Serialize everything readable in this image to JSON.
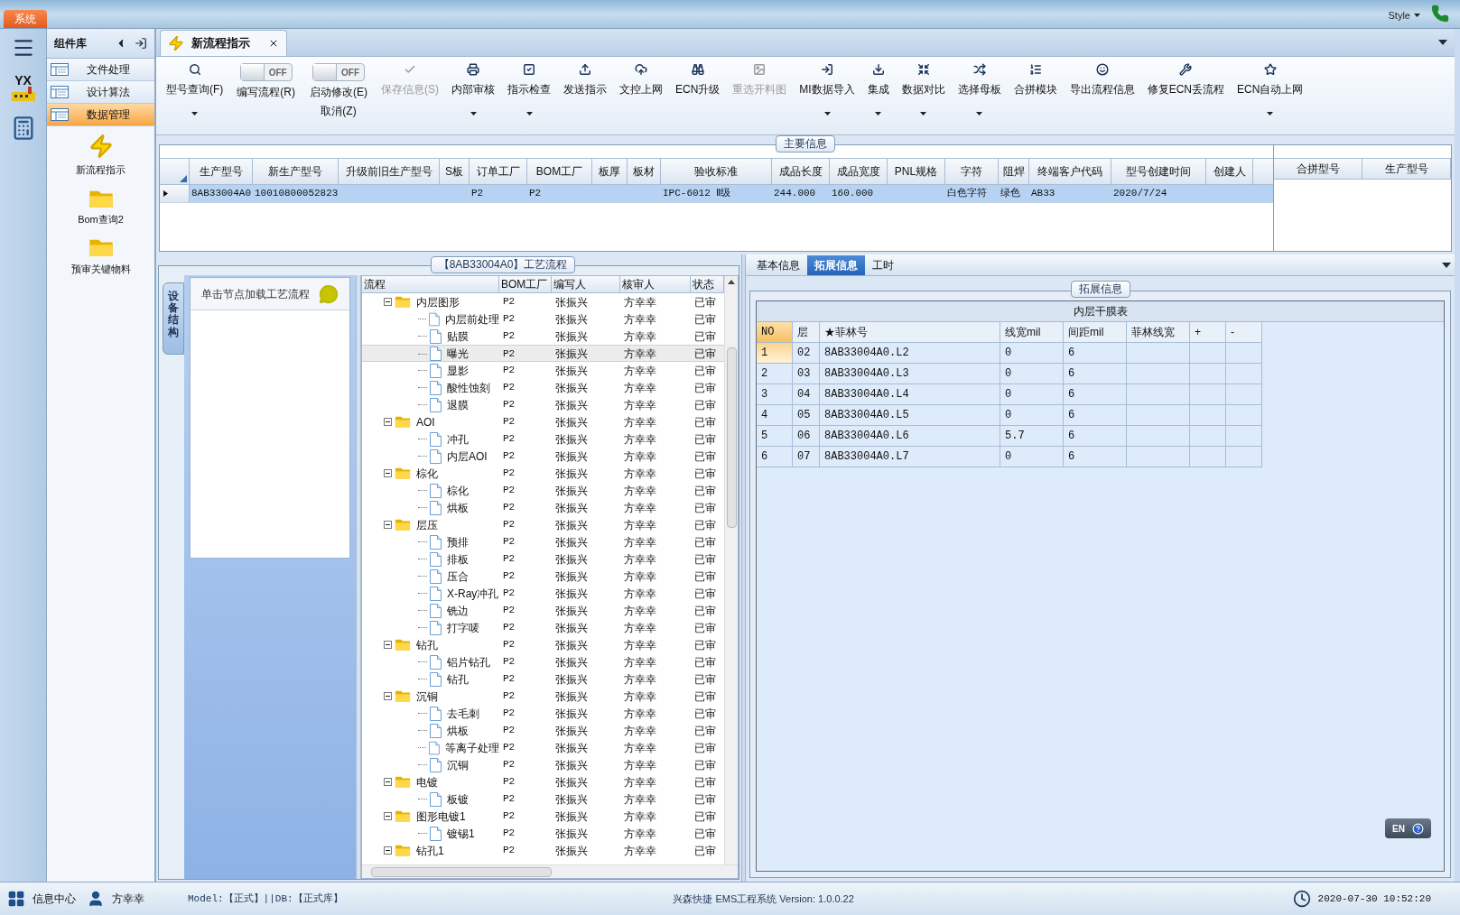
{
  "top_bar": {
    "system_tab": "系统",
    "style_menu": "Style"
  },
  "rail": {
    "logo_text": "YX"
  },
  "sidebar": {
    "title": "组件库",
    "items": [
      {
        "label": "文件处理",
        "selected": false
      },
      {
        "label": "设计算法",
        "selected": false
      },
      {
        "label": "数据管理",
        "selected": true
      }
    ],
    "shortcuts": [
      {
        "label": "新流程指示"
      },
      {
        "label": "Bom查询2"
      },
      {
        "label": "预审关键物料"
      }
    ]
  },
  "document_tabs": [
    {
      "label": "新流程指示",
      "selected": true
    }
  ],
  "toolbar": [
    {
      "kind": "button",
      "label": "型号查询(F)",
      "disabled": false,
      "dropdown": true
    },
    {
      "kind": "toggle",
      "label": "编写流程(R)",
      "on": false,
      "state_text": "OFF"
    },
    {
      "kind": "toggle",
      "label": "启动修改(E)",
      "sublabel": "取消(Z)",
      "on": false,
      "state_text": "OFF"
    },
    {
      "kind": "button",
      "label": "保存信息(S)",
      "disabled": true,
      "dropdown": false
    },
    {
      "kind": "button",
      "label": "内部审核",
      "disabled": false,
      "dropdown": true
    },
    {
      "kind": "button",
      "label": "指示检查",
      "disabled": false,
      "dropdown": true
    },
    {
      "kind": "button",
      "label": "发送指示",
      "disabled": false,
      "dropdown": false
    },
    {
      "kind": "button",
      "label": "文控上网",
      "disabled": false,
      "dropdown": false
    },
    {
      "kind": "button",
      "label": "ECN升级",
      "disabled": false,
      "dropdown": false
    },
    {
      "kind": "button",
      "label": "重选开料图",
      "disabled": true,
      "dropdown": false
    },
    {
      "kind": "button",
      "label": "MI数据导入",
      "disabled": false,
      "dropdown": true
    },
    {
      "kind": "button",
      "label": "集成",
      "disabled": false,
      "dropdown": true
    },
    {
      "kind": "button",
      "label": "数据对比",
      "disabled": false,
      "dropdown": true
    },
    {
      "kind": "button",
      "label": "选择母板",
      "disabled": false,
      "dropdown": true
    },
    {
      "kind": "button",
      "label": "合拼模块",
      "disabled": false,
      "dropdown": false
    },
    {
      "kind": "button",
      "label": "导出流程信息",
      "disabled": false,
      "dropdown": false
    },
    {
      "kind": "button",
      "label": "修复ECN丢流程",
      "disabled": false,
      "dropdown": false
    },
    {
      "kind": "button",
      "label": "ECN自动上网",
      "disabled": false,
      "dropdown": true
    }
  ],
  "main_info": {
    "title": "主要信息",
    "columns": [
      "生产型号",
      "新生产型号",
      "升级前旧生产型号",
      "S板",
      "订单工厂",
      "BOM工厂",
      "板厚",
      "板材",
      "验收标准",
      "成品长度",
      "成品宽度",
      "PNL规格",
      "字符",
      "阻焊",
      "终端客户代码",
      "型号创建时间",
      "创建人"
    ],
    "rows": [
      {
        "selected": true,
        "cells": [
          "8AB33004A0",
          "10010800052823",
          null,
          null,
          "P2",
          "P2",
          null,
          null,
          "IPC-6012 Ⅱ级",
          "244.000",
          "160.000",
          null,
          "白色字符",
          "绿色",
          "AB33",
          "2020/7/24",
          null
        ]
      }
    ],
    "merge_columns": [
      "合拼型号",
      "生产型号"
    ]
  },
  "process": {
    "title": "【8AB33004A0】工艺流程",
    "side_tab": "设备结构",
    "hint": "单击节点加载工艺流程",
    "columns": [
      "流程",
      "BOM工厂",
      "编写人",
      "核审人",
      "状态"
    ],
    "tree": [
      {
        "kind": "folder",
        "name": "内层图形",
        "bom": "P2",
        "writer": "张振兴",
        "reviewer": "方幸幸",
        "status": "已审",
        "expanded": true,
        "selected": false,
        "children": [
          {
            "kind": "step",
            "name": "内层前处理",
            "bom": "P2",
            "writer": "张振兴",
            "reviewer": "方幸幸",
            "status": "已审",
            "selected": false
          },
          {
            "kind": "step",
            "name": "贴膜",
            "bom": "P2",
            "writer": "张振兴",
            "reviewer": "方幸幸",
            "status": "已审",
            "selected": false
          },
          {
            "kind": "step",
            "name": "曝光",
            "bom": "P2",
            "writer": "张振兴",
            "reviewer": "方幸幸",
            "status": "已审",
            "selected": true
          },
          {
            "kind": "step",
            "name": "显影",
            "bom": "P2",
            "writer": "张振兴",
            "reviewer": "方幸幸",
            "status": "已审",
            "selected": false
          },
          {
            "kind": "step",
            "name": "酸性蚀刻",
            "bom": "P2",
            "writer": "张振兴",
            "reviewer": "方幸幸",
            "status": "已审",
            "selected": false
          },
          {
            "kind": "step",
            "name": "退膜",
            "bom": "P2",
            "writer": "张振兴",
            "reviewer": "方幸幸",
            "status": "已审",
            "selected": false
          }
        ]
      },
      {
        "kind": "folder",
        "name": "AOI",
        "bom": "P2",
        "writer": "张振兴",
        "reviewer": "方幸幸",
        "status": "已审",
        "expanded": true,
        "selected": false,
        "children": [
          {
            "kind": "step",
            "name": "冲孔",
            "bom": "P2",
            "writer": "张振兴",
            "reviewer": "方幸幸",
            "status": "已审",
            "selected": false
          },
          {
            "kind": "step",
            "name": "内层AOI",
            "bom": "P2",
            "writer": "张振兴",
            "reviewer": "方幸幸",
            "status": "已审",
            "selected": false
          }
        ]
      },
      {
        "kind": "folder",
        "name": "棕化",
        "bom": "P2",
        "writer": "张振兴",
        "reviewer": "方幸幸",
        "status": "已审",
        "expanded": true,
        "selected": false,
        "children": [
          {
            "kind": "step",
            "name": "棕化",
            "bom": "P2",
            "writer": "张振兴",
            "reviewer": "方幸幸",
            "status": "已审",
            "selected": false
          },
          {
            "kind": "step",
            "name": "烘板",
            "bom": "P2",
            "writer": "张振兴",
            "reviewer": "方幸幸",
            "status": "已审",
            "selected": false
          }
        ]
      },
      {
        "kind": "folder",
        "name": "层压",
        "bom": "P2",
        "writer": "张振兴",
        "reviewer": "方幸幸",
        "status": "已审",
        "expanded": true,
        "selected": false,
        "children": [
          {
            "kind": "step",
            "name": "预排",
            "bom": "P2",
            "writer": "张振兴",
            "reviewer": "方幸幸",
            "status": "已审",
            "selected": false
          },
          {
            "kind": "step",
            "name": "排板",
            "bom": "P2",
            "writer": "张振兴",
            "reviewer": "方幸幸",
            "status": "已审",
            "selected": false
          },
          {
            "kind": "step",
            "name": "压合",
            "bom": "P2",
            "writer": "张振兴",
            "reviewer": "方幸幸",
            "status": "已审",
            "selected": false
          },
          {
            "kind": "step",
            "name": "X-Ray冲孔",
            "bom": "P2",
            "writer": "张振兴",
            "reviewer": "方幸幸",
            "status": "已审",
            "selected": false
          },
          {
            "kind": "step",
            "name": "铣边",
            "bom": "P2",
            "writer": "张振兴",
            "reviewer": "方幸幸",
            "status": "已审",
            "selected": false
          },
          {
            "kind": "step",
            "name": "打字唛",
            "bom": "P2",
            "writer": "张振兴",
            "reviewer": "方幸幸",
            "status": "已审",
            "selected": false
          }
        ]
      },
      {
        "kind": "folder",
        "name": "钻孔",
        "bom": "P2",
        "writer": "张振兴",
        "reviewer": "方幸幸",
        "status": "已审",
        "expanded": true,
        "selected": false,
        "children": [
          {
            "kind": "step",
            "name": "铝片钻孔",
            "bom": "P2",
            "writer": "张振兴",
            "reviewer": "方幸幸",
            "status": "已审",
            "selected": false
          },
          {
            "kind": "step",
            "name": "钻孔",
            "bom": "P2",
            "writer": "张振兴",
            "reviewer": "方幸幸",
            "status": "已审",
            "selected": false
          }
        ]
      },
      {
        "kind": "folder",
        "name": "沉铜",
        "bom": "P2",
        "writer": "张振兴",
        "reviewer": "方幸幸",
        "status": "已审",
        "expanded": true,
        "selected": false,
        "children": [
          {
            "kind": "step",
            "name": "去毛刺",
            "bom": "P2",
            "writer": "张振兴",
            "reviewer": "方幸幸",
            "status": "已审",
            "selected": false
          },
          {
            "kind": "step",
            "name": "烘板",
            "bom": "P2",
            "writer": "张振兴",
            "reviewer": "方幸幸",
            "status": "已审",
            "selected": false
          },
          {
            "kind": "step",
            "name": "等离子处理",
            "bom": "P2",
            "writer": "张振兴",
            "reviewer": "方幸幸",
            "status": "已审",
            "selected": false
          },
          {
            "kind": "step",
            "name": "沉铜",
            "bom": "P2",
            "writer": "张振兴",
            "reviewer": "方幸幸",
            "status": "已审",
            "selected": false
          }
        ]
      },
      {
        "kind": "folder",
        "name": "电镀",
        "bom": "P2",
        "writer": "张振兴",
        "reviewer": "方幸幸",
        "status": "已审",
        "expanded": true,
        "selected": false,
        "children": [
          {
            "kind": "step",
            "name": "板镀",
            "bom": "P2",
            "writer": "张振兴",
            "reviewer": "方幸幸",
            "status": "已审",
            "selected": false
          }
        ]
      },
      {
        "kind": "folder",
        "name": "图形电镀1",
        "bom": "P2",
        "writer": "张振兴",
        "reviewer": "方幸幸",
        "status": "已审",
        "expanded": true,
        "selected": false,
        "children": [
          {
            "kind": "step",
            "name": "镀锡1",
            "bom": "P2",
            "writer": "张振兴",
            "reviewer": "方幸幸",
            "status": "已审",
            "selected": false
          }
        ]
      },
      {
        "kind": "folder",
        "name": "钻孔1",
        "bom": "P2",
        "writer": "张振兴",
        "reviewer": "方幸幸",
        "status": "已审",
        "expanded": true,
        "selected": false
      }
    ]
  },
  "details": {
    "tabs": [
      {
        "label": "基本信息",
        "selected": false
      },
      {
        "label": "拓展信息",
        "selected": true
      },
      {
        "label": "工时",
        "selected": false
      }
    ],
    "group_title": "拓展信息",
    "table": {
      "title": "内层干膜表",
      "columns": [
        "NO",
        "层",
        "★菲林号",
        "线宽mil",
        "间距mil",
        "菲林线宽",
        "+",
        "-"
      ],
      "rows": [
        {
          "selected": true,
          "cells": [
            "1",
            "02",
            "8AB33004A0.L2",
            "0",
            "6"
          ]
        },
        {
          "selected": false,
          "cells": [
            "2",
            "03",
            "8AB33004A0.L3",
            "0",
            "6"
          ]
        },
        {
          "selected": false,
          "cells": [
            "3",
            "04",
            "8AB33004A0.L4",
            "0",
            "6"
          ]
        },
        {
          "selected": false,
          "cells": [
            "4",
            "05",
            "8AB33004A0.L5",
            "0",
            "6"
          ]
        },
        {
          "selected": false,
          "cells": [
            "5",
            "06",
            "8AB33004A0.L6",
            "5.7",
            "6"
          ]
        },
        {
          "selected": false,
          "cells": [
            "6",
            "07",
            "8AB33004A0.L7",
            "0",
            "6"
          ]
        }
      ]
    }
  },
  "ime_widget": {
    "language": "EN"
  },
  "status_bar": {
    "info_center": "信息中心",
    "user": "方幸幸",
    "environment": "Model:【正式】||DB:【正式库】",
    "product": "兴森快捷 EMS工程系统 Version: 1.0.0.22",
    "datetime": "2020-07-30 10:52:20"
  }
}
